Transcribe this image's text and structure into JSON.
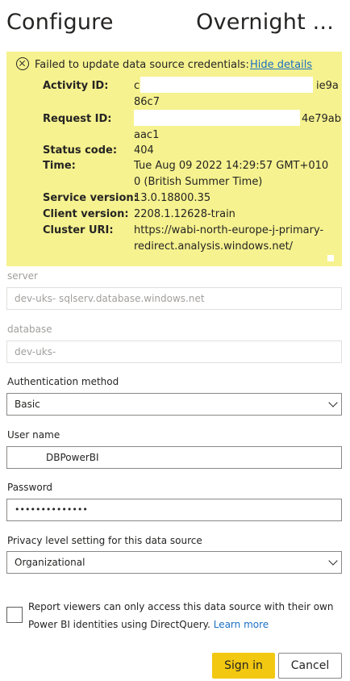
{
  "dialog": {
    "title_left": "Configure (",
    "title_right": "Overnight ..."
  },
  "error": {
    "message": "Failed to update data source credentials:",
    "toggle_link": "Hide details",
    "details": [
      {
        "label": "Activity ID:",
        "lines": [
          "c",
          "86c7"
        ],
        "tail": "ie9a"
      },
      {
        "label": "Request ID:",
        "lines": [
          "",
          "aac1"
        ],
        "tail": "4e79ab"
      },
      {
        "label": "Status code:",
        "lines": [
          "404"
        ]
      },
      {
        "label": "Time:",
        "lines": [
          "Tue Aug 09 2022 14:29:57 GMT+010",
          "0 (British Summer Time)"
        ]
      },
      {
        "label": "Service version:",
        "lines": [
          "13.0.18800.35"
        ]
      },
      {
        "label": "Client version:",
        "lines": [
          "2208.1.12628-train"
        ]
      },
      {
        "label": "Cluster URI:",
        "lines": [
          "https://wabi-north-europe-j-primary-",
          "redirect.analysis.windows.net/"
        ]
      }
    ]
  },
  "form": {
    "server": {
      "label": "server",
      "value": "dev-uks-            sqlserv.database.windows.net"
    },
    "database": {
      "label": "database",
      "value": "dev-uks-"
    },
    "auth": {
      "label": "Authentication method",
      "value": "Basic"
    },
    "username": {
      "label": "User name",
      "value": "DBPowerBI"
    },
    "password": {
      "label": "Password",
      "value": "••••••••••••••"
    },
    "privacy": {
      "label": "Privacy level setting for this data source",
      "value": "Organizational"
    },
    "sso": {
      "line1": "Report viewers can only access this data source with their own",
      "line2": "Power BI identities using DirectQuery.",
      "link": "Learn more",
      "checked": false
    }
  },
  "buttons": {
    "sign_in": "Sign in",
    "cancel": "Cancel"
  },
  "colors": {
    "error_bg": "#f6f28f",
    "primary": "#f2c811",
    "link": "#1a6fc4"
  }
}
